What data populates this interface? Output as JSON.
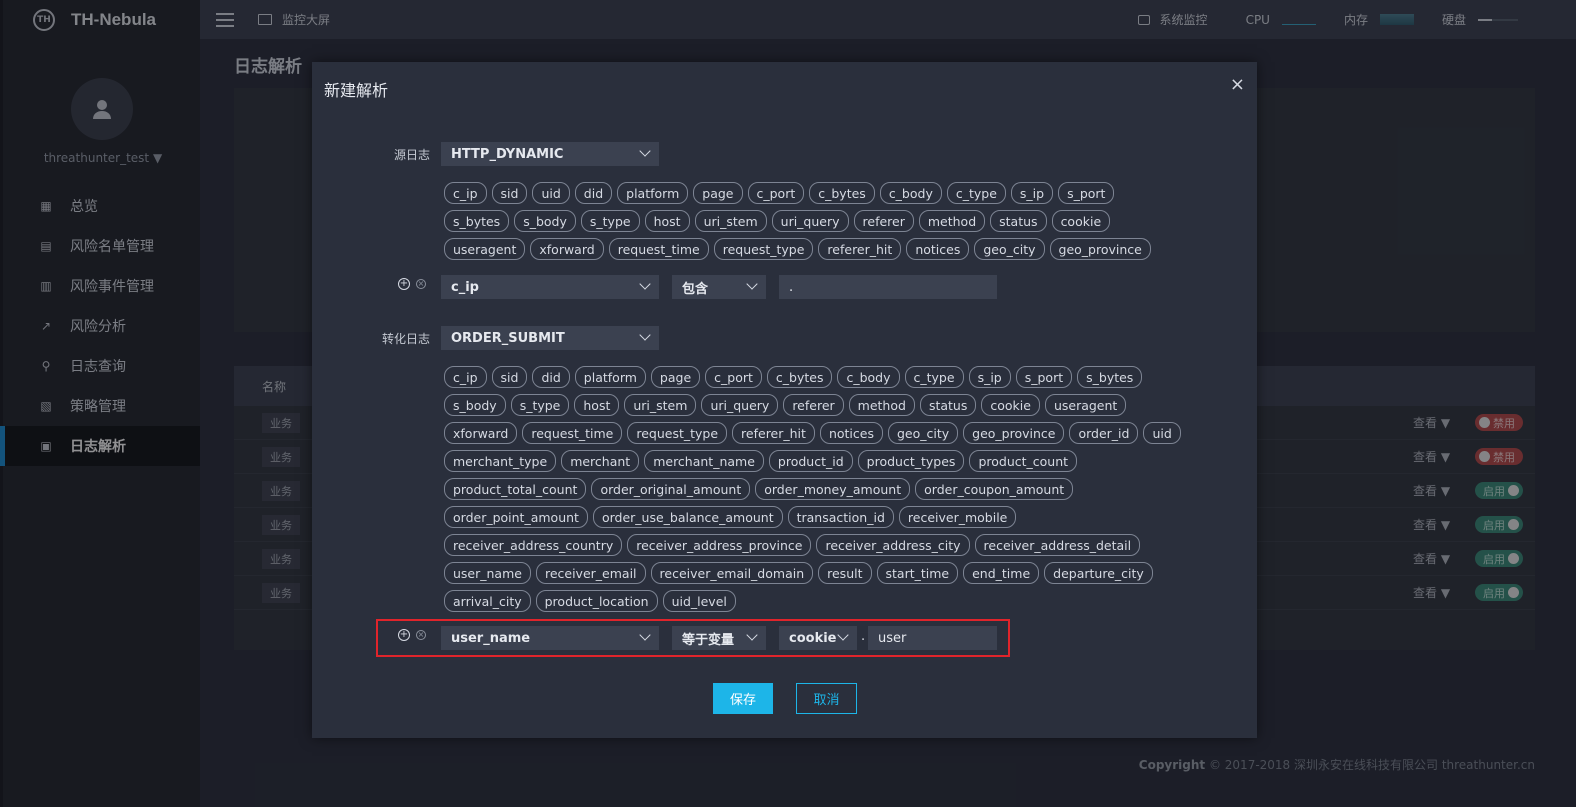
{
  "app": {
    "name": "TH-Nebula",
    "logo_mark": "TH"
  },
  "user": {
    "name": "threathunter_test"
  },
  "menu": [
    {
      "label": "总览",
      "icon": "grid-icon",
      "active": false
    },
    {
      "label": "风险名单管理",
      "icon": "list-icon",
      "active": false
    },
    {
      "label": "风险事件管理",
      "icon": "event-icon",
      "active": false
    },
    {
      "label": "风险分析",
      "icon": "chart-icon",
      "active": false
    },
    {
      "label": "日志查询",
      "icon": "search-icon",
      "active": false
    },
    {
      "label": "策略管理",
      "icon": "strategy-icon",
      "active": false
    },
    {
      "label": "日志解析",
      "icon": "doc-icon",
      "active": true
    }
  ],
  "topbar": {
    "screen": "监控大屏",
    "sysmon": "系统监控",
    "cpu": "CPU",
    "mem": "内存",
    "disk": "硬盘"
  },
  "page": {
    "title": "日志解析",
    "col_name": "名称",
    "copyright_bold": "Copyright",
    "copyright": "© 2017-2018 深圳永安在线科技有限公司 threathunter.cn"
  },
  "rows": [
    {
      "tag": "业务",
      "view": "查看",
      "status": "禁用",
      "on": false
    },
    {
      "tag": "业务",
      "view": "查看",
      "status": "禁用",
      "on": false
    },
    {
      "tag": "业务",
      "view": "查看",
      "status": "启用",
      "on": true
    },
    {
      "tag": "业务",
      "view": "查看",
      "status": "启用",
      "on": true
    },
    {
      "tag": "业务",
      "view": "查看",
      "status": "启用",
      "on": true
    },
    {
      "tag": "业务",
      "view": "查看",
      "status": "启用",
      "on": true
    }
  ],
  "modal": {
    "title": "新建解析",
    "source_label": "源日志",
    "source_value": "HTTP_DYNAMIC",
    "source_fields": [
      "c_ip",
      "sid",
      "uid",
      "did",
      "platform",
      "page",
      "c_port",
      "c_bytes",
      "c_body",
      "c_type",
      "s_ip",
      "s_port",
      "s_bytes",
      "s_body",
      "s_type",
      "host",
      "uri_stem",
      "uri_query",
      "referer",
      "method",
      "status",
      "cookie",
      "useragent",
      "xforward",
      "request_time",
      "request_type",
      "referer_hit",
      "notices",
      "geo_city",
      "geo_province"
    ],
    "cond1": {
      "field": "c_ip",
      "op": "包含",
      "value": "."
    },
    "target_label": "转化日志",
    "target_value": "ORDER_SUBMIT",
    "target_fields": [
      "c_ip",
      "sid",
      "did",
      "platform",
      "page",
      "c_port",
      "c_bytes",
      "c_body",
      "c_type",
      "s_ip",
      "s_port",
      "s_bytes",
      "s_body",
      "s_type",
      "host",
      "uri_stem",
      "uri_query",
      "referer",
      "method",
      "status",
      "cookie",
      "useragent",
      "xforward",
      "request_time",
      "request_type",
      "referer_hit",
      "notices",
      "geo_city",
      "geo_province",
      "order_id",
      "uid",
      "merchant_type",
      "merchant",
      "merchant_name",
      "product_id",
      "product_types",
      "product_count",
      "product_total_count",
      "order_original_amount",
      "order_money_amount",
      "order_coupon_amount",
      "order_point_amount",
      "order_use_balance_amount",
      "transaction_id",
      "receiver_mobile",
      "receiver_address_country",
      "receiver_address_province",
      "receiver_address_city",
      "receiver_address_detail",
      "user_name",
      "receiver_email",
      "receiver_email_domain",
      "result",
      "start_time",
      "end_time",
      "departure_city",
      "arrival_city",
      "product_location",
      "uid_level"
    ],
    "cond2": {
      "field": "user_name",
      "op": "等于变量",
      "var": "cookie",
      "sep": ".",
      "value": "user"
    },
    "save": "保存",
    "cancel": "取消",
    "close": "×"
  }
}
